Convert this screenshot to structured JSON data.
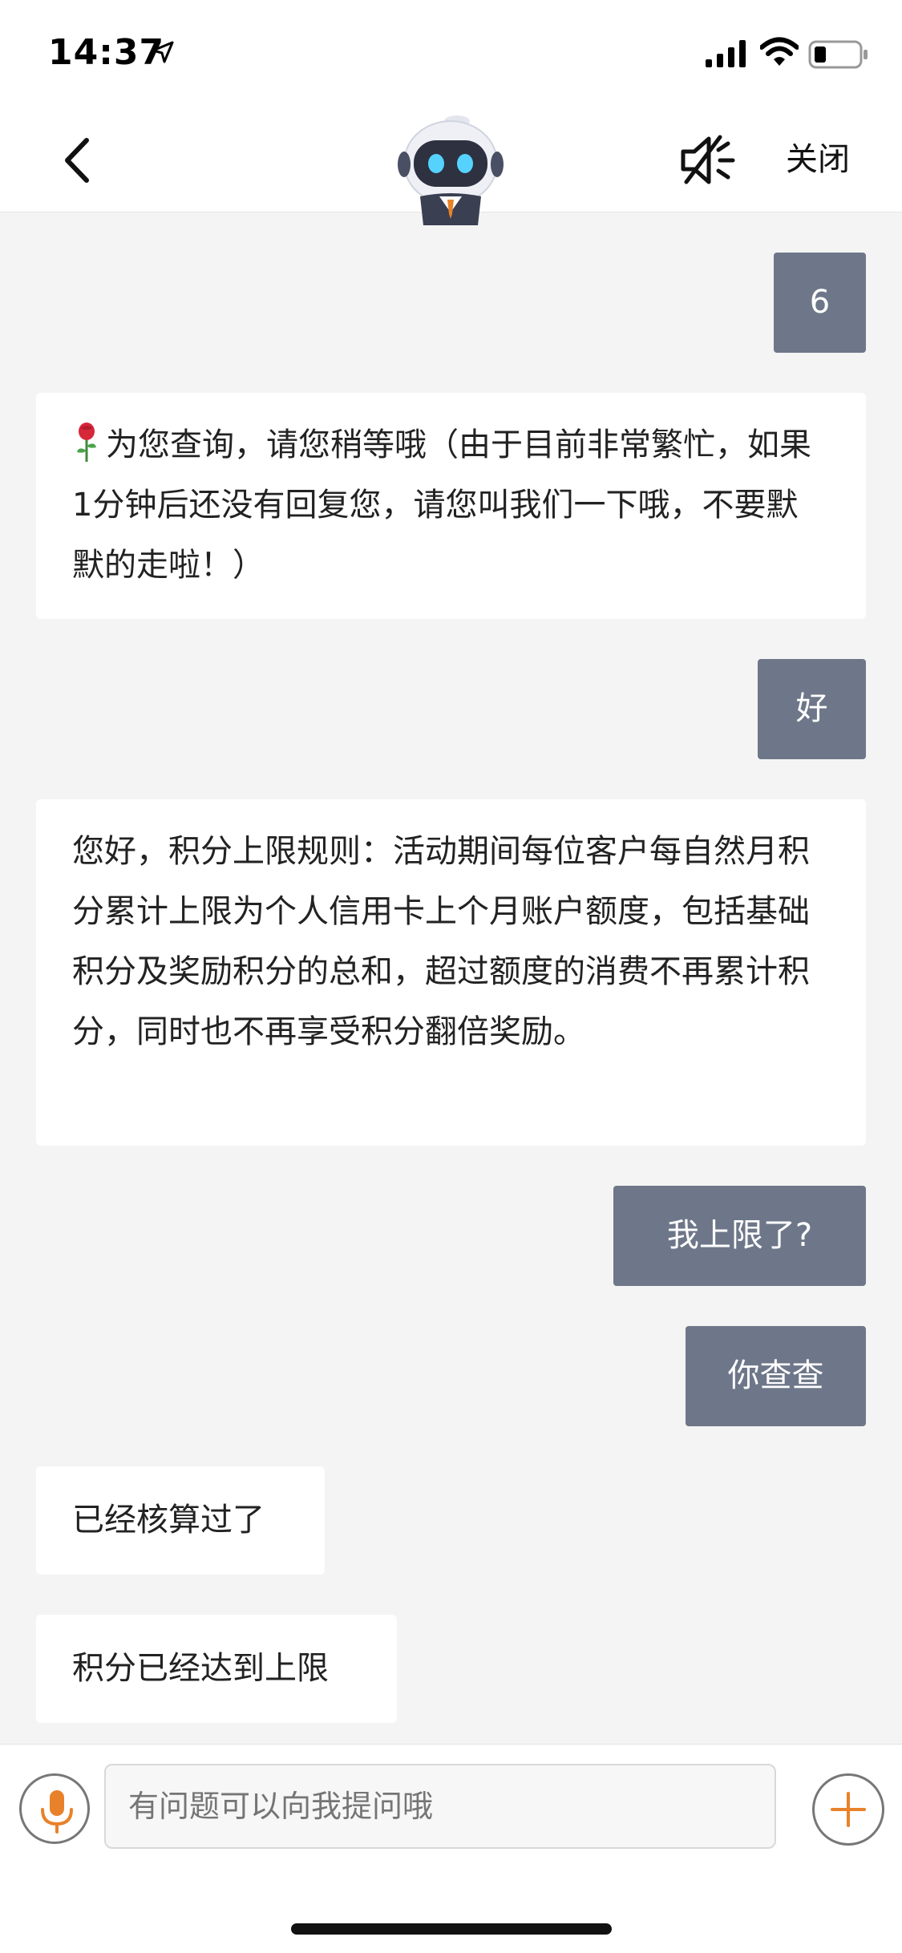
{
  "status_bar": {
    "time": "14:37",
    "icons": [
      "location-arrow-icon",
      "cellular-signal-icon",
      "wifi-icon",
      "battery-icon"
    ]
  },
  "nav": {
    "back_icon": "chevron-left-icon",
    "avatar_icon": "robot-assistant-icon",
    "mute_icon": "speaker-muted-icon",
    "close_label": "关闭"
  },
  "messages": [
    {
      "role": "user",
      "text": "6"
    },
    {
      "role": "bot",
      "icon": "rose-icon",
      "text": "为您查询，请您稍等哦（由于目前非常繁忙，如果1分钟后还没有回复您，请您叫我们一下哦，不要默默的走啦！）"
    },
    {
      "role": "user",
      "text": "好"
    },
    {
      "role": "bot",
      "text": "您好，积分上限规则：活动期间每位客户每自然月积分累计上限为个人信用卡上个月账户额度，包括基础积分及奖励积分的总和，超过额度的消费不再累计积分，同时也不再享受积分翻倍奖励。"
    },
    {
      "role": "user",
      "text": "我上限了?"
    },
    {
      "role": "user",
      "text": "你查查"
    },
    {
      "role": "bot",
      "text": "已经核算过了"
    },
    {
      "role": "bot",
      "text": "积分已经达到上限"
    }
  ],
  "input": {
    "placeholder": "有问题可以向我提问哦",
    "mic_icon": "microphone-icon",
    "plus_icon": "plus-icon"
  },
  "colors": {
    "user_bubble": "#6e7789",
    "bot_bubble": "#ffffff",
    "background": "#f4f4f4",
    "accent": "#e8822a"
  }
}
